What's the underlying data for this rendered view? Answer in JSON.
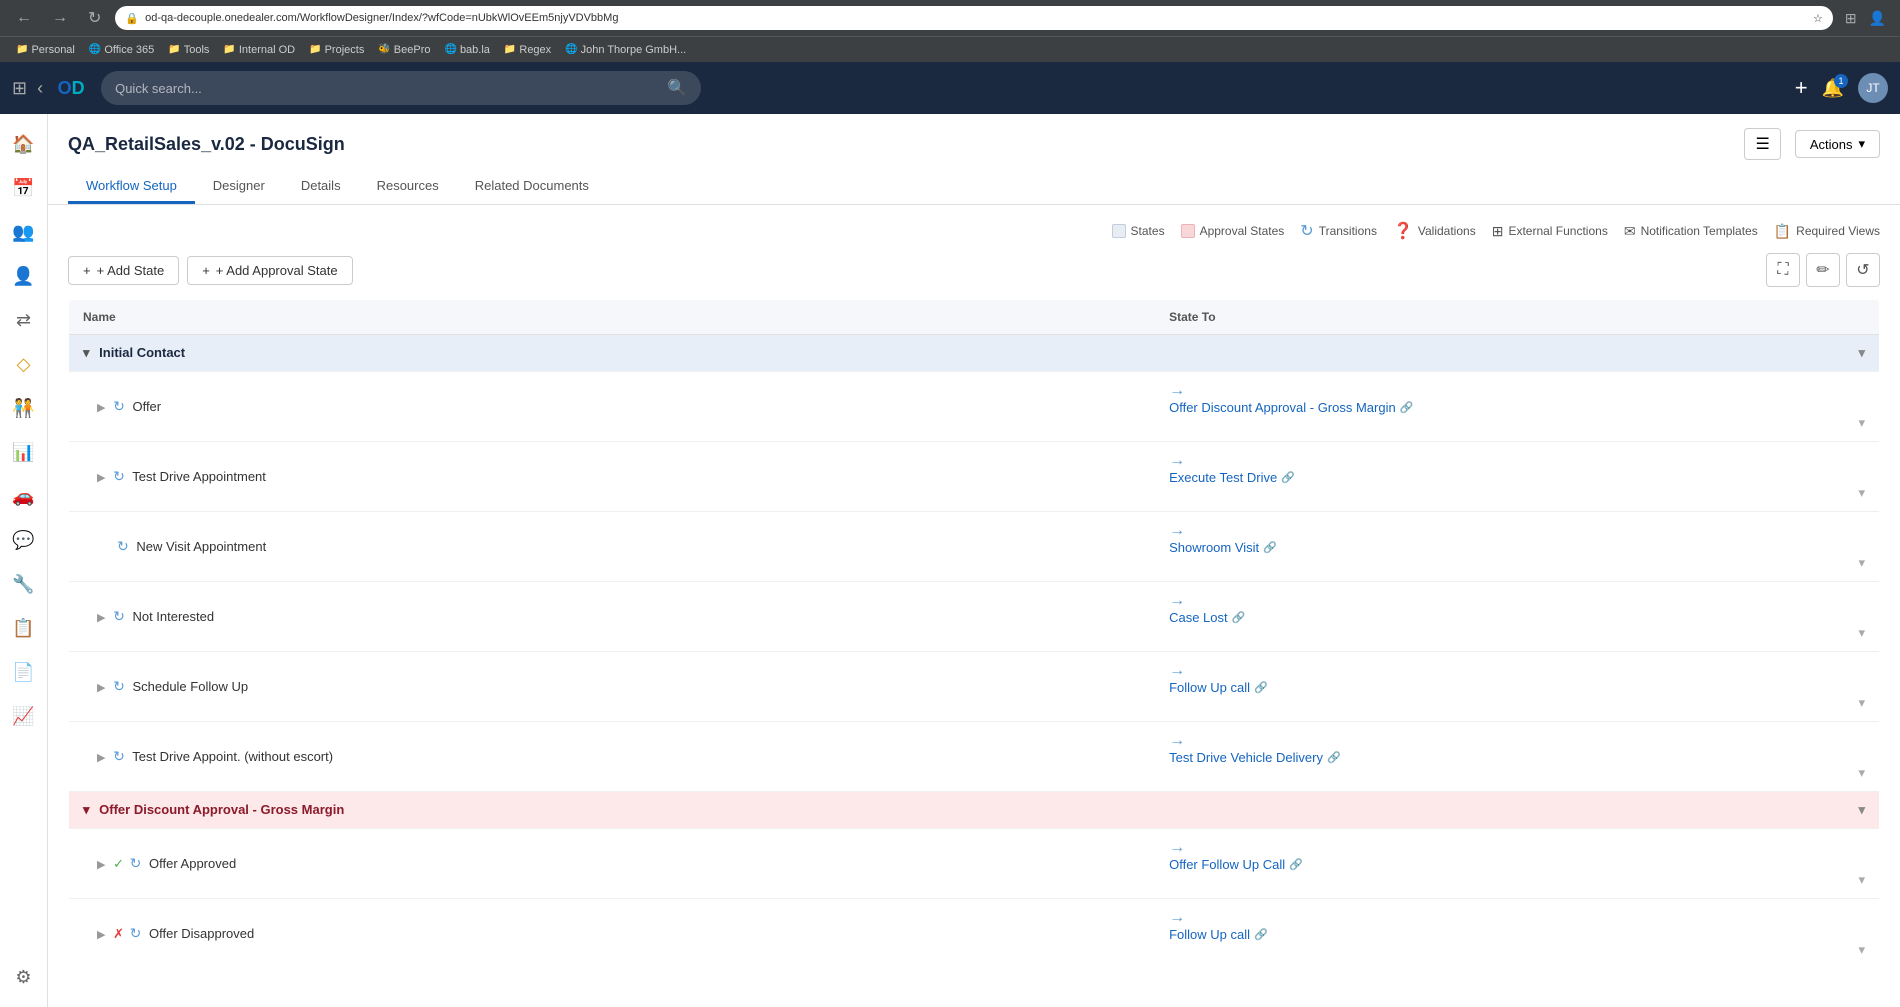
{
  "browser": {
    "url": "od-qa-decouple.onedealer.com/WorkflowDesigner/Index/?wfCode=nUbkWlOvEEm5njyVDVbbMg",
    "search_placeholder": "Quick search..."
  },
  "bookmarks": [
    {
      "label": "Personal",
      "icon": "📁"
    },
    {
      "label": "Office 365",
      "icon": "🌐"
    },
    {
      "label": "Tools",
      "icon": "📁"
    },
    {
      "label": "Internal OD",
      "icon": "📁"
    },
    {
      "label": "Projects",
      "icon": "📁"
    },
    {
      "label": "BeePro",
      "icon": "🐝"
    },
    {
      "label": "bab.la",
      "icon": "🌐"
    },
    {
      "label": "Regex",
      "icon": "📁"
    },
    {
      "label": "John Thorpe GmbH...",
      "icon": "🌐"
    }
  ],
  "page": {
    "title": "QA_RetailSales_v.02 - DocuSign",
    "actions_label": "Actions",
    "list_icon": "☰"
  },
  "tabs": [
    {
      "label": "Workflow Setup",
      "active": true
    },
    {
      "label": "Designer"
    },
    {
      "label": "Details"
    },
    {
      "label": "Resources"
    },
    {
      "label": "Related Documents"
    }
  ],
  "legend": [
    {
      "label": "States",
      "type": "states"
    },
    {
      "label": "Approval States",
      "type": "approval"
    },
    {
      "label": "Transitions",
      "type": "transitions"
    },
    {
      "label": "Validations",
      "type": "validations"
    },
    {
      "label": "External Functions",
      "type": "external"
    },
    {
      "label": "Notification Templates",
      "type": "notification"
    },
    {
      "label": "Required Views",
      "type": "required"
    }
  ],
  "toolbar": {
    "add_state_label": "+ Add State",
    "add_approval_label": "+ Add Approval State",
    "expand_icon": "⛶",
    "edit_icon": "✏",
    "reset_icon": "↺"
  },
  "table": {
    "col_name": "Name",
    "col_state_to": "State To",
    "groups": [
      {
        "id": "initial-contact",
        "label": "Initial Contact",
        "type": "state",
        "transitions": [
          {
            "name": "Offer",
            "state_to": "Offer Discount Approval - Gross Margin",
            "has_link": true,
            "check": null
          },
          {
            "name": "Test Drive Appointment",
            "state_to": "Execute Test Drive",
            "has_link": true,
            "check": null
          },
          {
            "name": "New Visit Appointment",
            "state_to": "Showroom Visit",
            "has_link": true,
            "check": null
          },
          {
            "name": "Not Interested",
            "state_to": "Case Lost",
            "has_link": true,
            "check": null
          },
          {
            "name": "Schedule Follow Up",
            "state_to": "Follow Up call",
            "has_link": true,
            "check": null
          },
          {
            "name": "Test Drive Appoint. (without escort)",
            "state_to": "Test Drive Vehicle Delivery",
            "has_link": true,
            "check": null
          }
        ]
      },
      {
        "id": "offer-discount-approval",
        "label": "Offer Discount Approval - Gross Margin",
        "type": "approval",
        "transitions": [
          {
            "name": "Offer Approved",
            "state_to": "Offer Follow Up Call",
            "has_link": true,
            "check": "check"
          },
          {
            "name": "Offer Disapproved",
            "state_to": "Follow Up call",
            "has_link": true,
            "check": "x"
          }
        ]
      }
    ]
  },
  "sidebar_icons": [
    {
      "name": "home-icon",
      "symbol": "🏠"
    },
    {
      "name": "calendar-icon",
      "symbol": "📅"
    },
    {
      "name": "people-icon",
      "symbol": "👥"
    },
    {
      "name": "person-icon",
      "symbol": "👤"
    },
    {
      "name": "arrows-icon",
      "symbol": "⇄"
    },
    {
      "name": "diamond-icon",
      "symbol": "◇"
    },
    {
      "name": "user-plus-icon",
      "symbol": "👤"
    },
    {
      "name": "graph-icon",
      "symbol": "📊"
    },
    {
      "name": "car-icon",
      "symbol": "🚗"
    },
    {
      "name": "chat-icon",
      "symbol": "💬"
    },
    {
      "name": "tools-icon",
      "symbol": "🔧"
    },
    {
      "name": "task-icon",
      "symbol": "📋"
    },
    {
      "name": "document-icon",
      "symbol": "📄"
    },
    {
      "name": "chart-icon",
      "symbol": "📈"
    }
  ]
}
